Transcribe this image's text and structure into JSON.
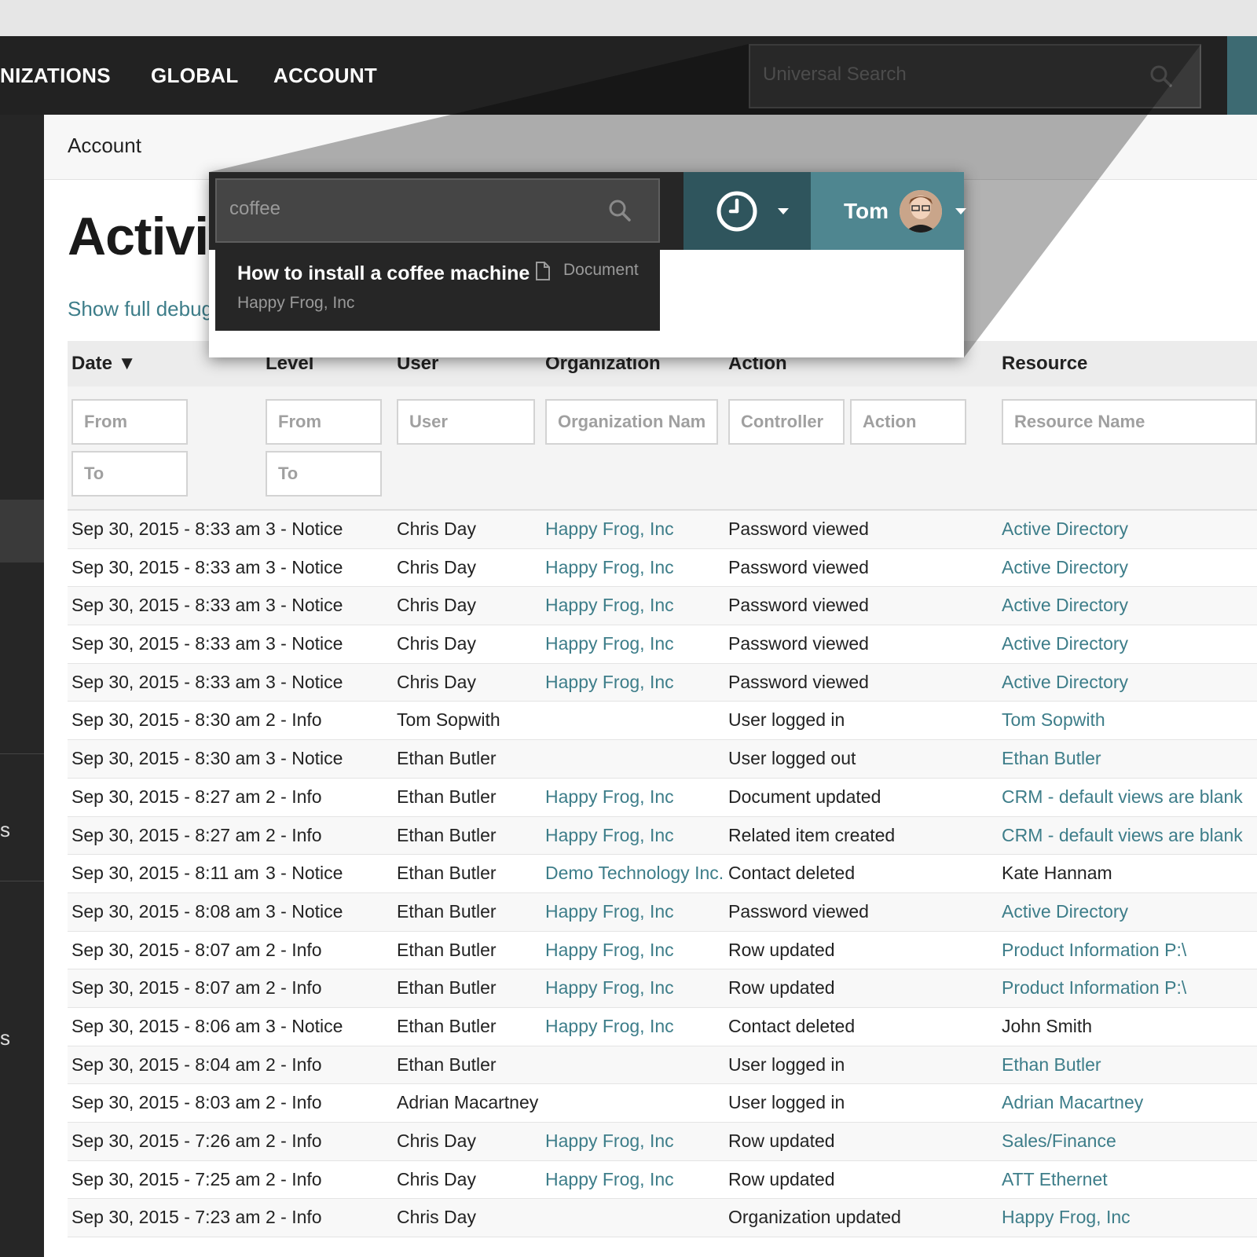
{
  "nav": {
    "items": [
      "NIZATIONS",
      "GLOBAL",
      "ACCOUNT"
    ],
    "search_placeholder": "Universal Search"
  },
  "sidebar": {
    "fragments": [
      "s",
      "s"
    ]
  },
  "breadcrumb": "Account",
  "page_title": "Activit",
  "debug_link": "Show full debug",
  "table": {
    "headers": [
      "Date ▼",
      "Level",
      "User",
      "Organization",
      "Action",
      "Resource"
    ],
    "filters": {
      "date_from": "From",
      "date_to": "To",
      "level_from": "From",
      "level_to": "To",
      "user": "User",
      "organization": "Organization Nam",
      "controller": "Controller",
      "action": "Action",
      "resource": "Resource Name"
    },
    "rows": [
      {
        "date": "Sep 30, 2015 - 8:33 am",
        "level": "3 - Notice",
        "user": "Chris Day",
        "org": "Happy Frog, Inc",
        "action": "Password viewed",
        "resource": "Active Directory",
        "resource_link": true
      },
      {
        "date": "Sep 30, 2015 - 8:33 am",
        "level": "3 - Notice",
        "user": "Chris Day",
        "org": "Happy Frog, Inc",
        "action": "Password viewed",
        "resource": "Active Directory",
        "resource_link": true
      },
      {
        "date": "Sep 30, 2015 - 8:33 am",
        "level": "3 - Notice",
        "user": "Chris Day",
        "org": "Happy Frog, Inc",
        "action": "Password viewed",
        "resource": "Active Directory",
        "resource_link": true
      },
      {
        "date": "Sep 30, 2015 - 8:33 am",
        "level": "3 - Notice",
        "user": "Chris Day",
        "org": "Happy Frog, Inc",
        "action": "Password viewed",
        "resource": "Active Directory",
        "resource_link": true
      },
      {
        "date": "Sep 30, 2015 - 8:33 am",
        "level": "3 - Notice",
        "user": "Chris Day",
        "org": "Happy Frog, Inc",
        "action": "Password viewed",
        "resource": "Active Directory",
        "resource_link": true
      },
      {
        "date": "Sep 30, 2015 - 8:30 am",
        "level": "2 - Info",
        "user": "Tom Sopwith",
        "org": "",
        "action": "User logged in",
        "resource": "Tom Sopwith",
        "resource_link": true
      },
      {
        "date": "Sep 30, 2015 - 8:30 am",
        "level": "3 - Notice",
        "user": "Ethan Butler",
        "org": "",
        "action": "User logged out",
        "resource": "Ethan Butler",
        "resource_link": true
      },
      {
        "date": "Sep 30, 2015 - 8:27 am",
        "level": "2 - Info",
        "user": "Ethan Butler",
        "org": "Happy Frog, Inc",
        "action": "Document updated",
        "resource": "CRM - default views are blank",
        "resource_link": true
      },
      {
        "date": "Sep 30, 2015 - 8:27 am",
        "level": "2 - Info",
        "user": "Ethan Butler",
        "org": "Happy Frog, Inc",
        "action": "Related item created",
        "resource": "CRM - default views are blank",
        "resource_link": true
      },
      {
        "date": "Sep 30, 2015 - 8:11 am",
        "level": "3 - Notice",
        "user": "Ethan Butler",
        "org": "Demo Technology Inc.",
        "action": "Contact deleted",
        "resource": "Kate Hannam",
        "resource_link": false
      },
      {
        "date": "Sep 30, 2015 - 8:08 am",
        "level": "3 - Notice",
        "user": "Ethan Butler",
        "org": "Happy Frog, Inc",
        "action": "Password viewed",
        "resource": "Active Directory",
        "resource_link": true
      },
      {
        "date": "Sep 30, 2015 - 8:07 am",
        "level": "2 - Info",
        "user": "Ethan Butler",
        "org": "Happy Frog, Inc",
        "action": "Row updated",
        "resource": "Product Information P:\\",
        "resource_link": true
      },
      {
        "date": "Sep 30, 2015 - 8:07 am",
        "level": "2 - Info",
        "user": "Ethan Butler",
        "org": "Happy Frog, Inc",
        "action": "Row updated",
        "resource": "Product Information P:\\",
        "resource_link": true
      },
      {
        "date": "Sep 30, 2015 - 8:06 am",
        "level": "3 - Notice",
        "user": "Ethan Butler",
        "org": "Happy Frog, Inc",
        "action": "Contact deleted",
        "resource": "John Smith",
        "resource_link": false
      },
      {
        "date": "Sep 30, 2015 - 8:04 am",
        "level": "2 - Info",
        "user": "Ethan Butler",
        "org": "",
        "action": "User logged in",
        "resource": "Ethan Butler",
        "resource_link": true
      },
      {
        "date": "Sep 30, 2015 - 8:03 am",
        "level": "2 - Info",
        "user": "Adrian Macartney",
        "org": "",
        "action": "User logged in",
        "resource": "Adrian Macartney",
        "resource_link": true
      },
      {
        "date": "Sep 30, 2015 - 7:26 am",
        "level": "2 - Info",
        "user": "Chris Day",
        "org": "Happy Frog, Inc",
        "action": "Row updated",
        "resource": "Sales/Finance",
        "resource_link": true
      },
      {
        "date": "Sep 30, 2015 - 7:25 am",
        "level": "2 - Info",
        "user": "Chris Day",
        "org": "Happy Frog, Inc",
        "action": "Row updated",
        "resource": "ATT Ethernet",
        "resource_link": true
      },
      {
        "date": "Sep 30, 2015 - 7:23 am",
        "level": "2 - Info",
        "user": "Chris Day",
        "org": "",
        "action": "Organization updated",
        "resource": "Happy Frog, Inc",
        "resource_link": true
      }
    ]
  },
  "popup": {
    "search_value": "coffee",
    "result": {
      "title": "How to install a coffee machine",
      "subtitle": "Happy Frog, Inc",
      "type": "Document"
    },
    "user_name": "Tom"
  },
  "colors": {
    "nav_bg": "#222222",
    "link": "#3d7d89",
    "clock_bg": "#2f555d",
    "user_bg": "#4f8690"
  },
  "icons": [
    "search-icon",
    "clock-icon",
    "chevron-down-icon",
    "document-icon",
    "avatar"
  ]
}
